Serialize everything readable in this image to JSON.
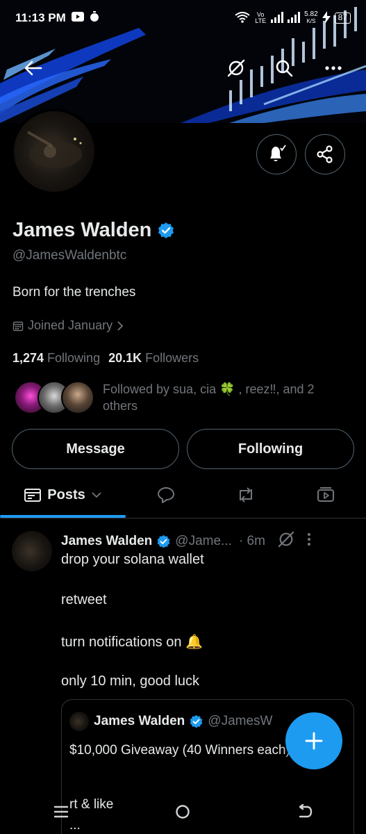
{
  "status_bar": {
    "time": "11:13 PM",
    "net_speed": "5.82",
    "net_unit": "K/S",
    "volte": "Vo LTE",
    "battery": "87"
  },
  "profile": {
    "name": "James Walden",
    "handle": "@JamesWaldenbtc",
    "bio": "Born for the trenches",
    "joined": "Joined January",
    "following_count": "1,274",
    "following_label": "Following",
    "followers_count": "20.1K",
    "followers_label": "Followers",
    "followed_by": "Followed by sua, cia 🍀 , reez‼, and 2 others"
  },
  "actions": {
    "message_label": "Message",
    "following_label": "Following"
  },
  "tabs": {
    "posts_label": "Posts"
  },
  "post": {
    "author_name": "James Walden",
    "author_handle": "@Jame...",
    "time": "· 6m",
    "lines": [
      "drop your solana wallet",
      "retweet",
      "turn notifications on 🔔",
      "only 10 min, good luck"
    ],
    "quote": {
      "author_name": "James Walden",
      "author_handle": "@JamesW",
      "text": "$10,000 Giveaway (40 Winners  each)",
      "line2": "rt & like",
      "line3": "..."
    }
  },
  "colors": {
    "accent": "#1d9bf0",
    "muted": "#71767b",
    "border": "#2f3336",
    "text": "#e7e9ea"
  },
  "icons": {
    "back": "back-arrow-icon",
    "grok": "grok-icon",
    "search": "search-icon",
    "more": "more-icon",
    "bell": "notification-bell-icon",
    "share": "share-icon",
    "verified": "verified-badge-icon",
    "calendar": "calendar-icon",
    "reply": "reply-icon",
    "retweet": "retweet-icon",
    "media": "media-icon",
    "compose": "compose-plus-icon"
  }
}
